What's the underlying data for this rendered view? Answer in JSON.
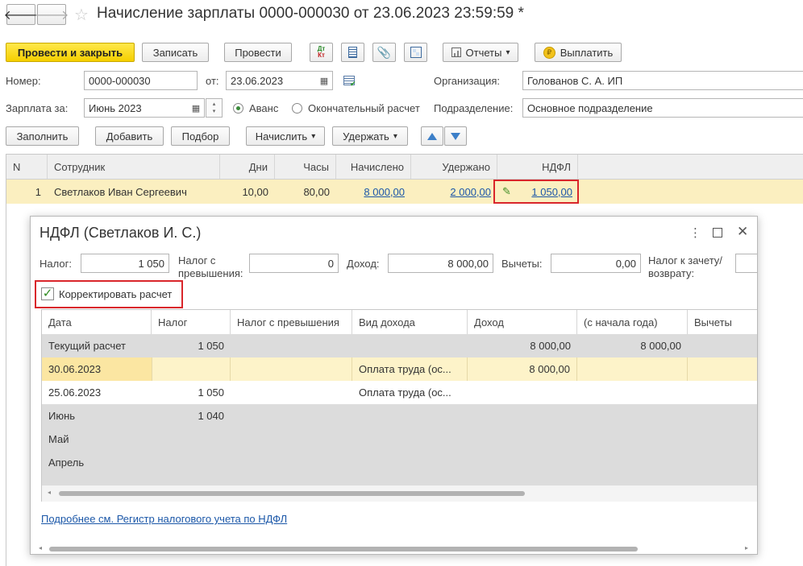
{
  "window": {
    "title": "Начисление зарплаты 0000-000030 от 23.06.2023 23:59:59 *"
  },
  "toolbar": {
    "post_close": "Провести и закрыть",
    "save": "Записать",
    "post": "Провести",
    "dtkt_top": "Дт",
    "dtkt_bottom": "Кт",
    "reports": "Отчеты",
    "pay": "Выплатить"
  },
  "form": {
    "number_label": "Номер:",
    "number_value": "0000-000030",
    "date_label": "от:",
    "date_value": "23.06.2023",
    "org_label": "Организация:",
    "org_value": "Голованов С. А. ИП",
    "salary_label": "Зарплата за:",
    "salary_value": "Июнь 2023",
    "advance_label": "Аванс",
    "final_label": "Окончательный расчет",
    "division_label": "Подразделение:",
    "division_value": "Основное подразделение"
  },
  "table_toolbar": {
    "fill": "Заполнить",
    "add": "Добавить",
    "pick": "Подбор",
    "accrue": "Начислить",
    "withhold": "Удержать"
  },
  "main_table": {
    "columns": [
      "N",
      "Сотрудник",
      "Дни",
      "Часы",
      "Начислено",
      "Удержано",
      "НДФЛ"
    ],
    "rows": [
      {
        "n": "1",
        "employee": "Светлаков Иван Сергеевич",
        "days": "10,00",
        "hours": "80,00",
        "accrued": "8 000,00",
        "withheld": "2 000,00",
        "ndfl": "1 050,00"
      }
    ]
  },
  "popup": {
    "title": "НДФЛ (Светлаков И. С.)",
    "tax_label": "Налог:",
    "tax_value": "1 050",
    "excess_label_1": "Налог с",
    "excess_label_2": "превышения:",
    "excess_value": "0",
    "income_label": "Доход:",
    "income_value": "8 000,00",
    "deductions_label": "Вычеты:",
    "deductions_value": "0,00",
    "offset_label_1": "Налог к зачету/",
    "offset_label_2": "возврату:",
    "correct_label": "Корректировать расчет",
    "columns": [
      "Дата",
      "Налог",
      "Налог с превышения",
      "Вид дохода",
      "Доход",
      "(с начала года)",
      "Вычеты"
    ],
    "rows": [
      {
        "date": "Текущий расчет",
        "tax": "1 050",
        "excess": "",
        "kind": "",
        "income": "8 000,00",
        "ytd": "8 000,00",
        "ded": ""
      },
      {
        "date": "30.06.2023",
        "tax": "",
        "excess": "",
        "kind": "Оплата труда (ос...",
        "income": "8 000,00",
        "ytd": "",
        "ded": ""
      },
      {
        "date": "25.06.2023",
        "tax": "1 050",
        "excess": "",
        "kind": "Оплата труда (ос...",
        "income": "",
        "ytd": "",
        "ded": ""
      },
      {
        "date": "Июнь",
        "tax": "1 040",
        "excess": "",
        "kind": "",
        "income": "",
        "ytd": "",
        "ded": ""
      },
      {
        "date": "Май",
        "tax": "",
        "excess": "",
        "kind": "",
        "income": "",
        "ytd": "",
        "ded": ""
      },
      {
        "date": "Апрель",
        "tax": "",
        "excess": "",
        "kind": "",
        "income": "",
        "ytd": "",
        "ded": ""
      }
    ],
    "link": "Подробнее см. Регистр налогового учета по НДФЛ"
  },
  "colors": {
    "primary_button": "#f5cf00",
    "selected_row": "#fbefc0",
    "highlight_border": "#d9262b",
    "link": "#1b57a8"
  }
}
